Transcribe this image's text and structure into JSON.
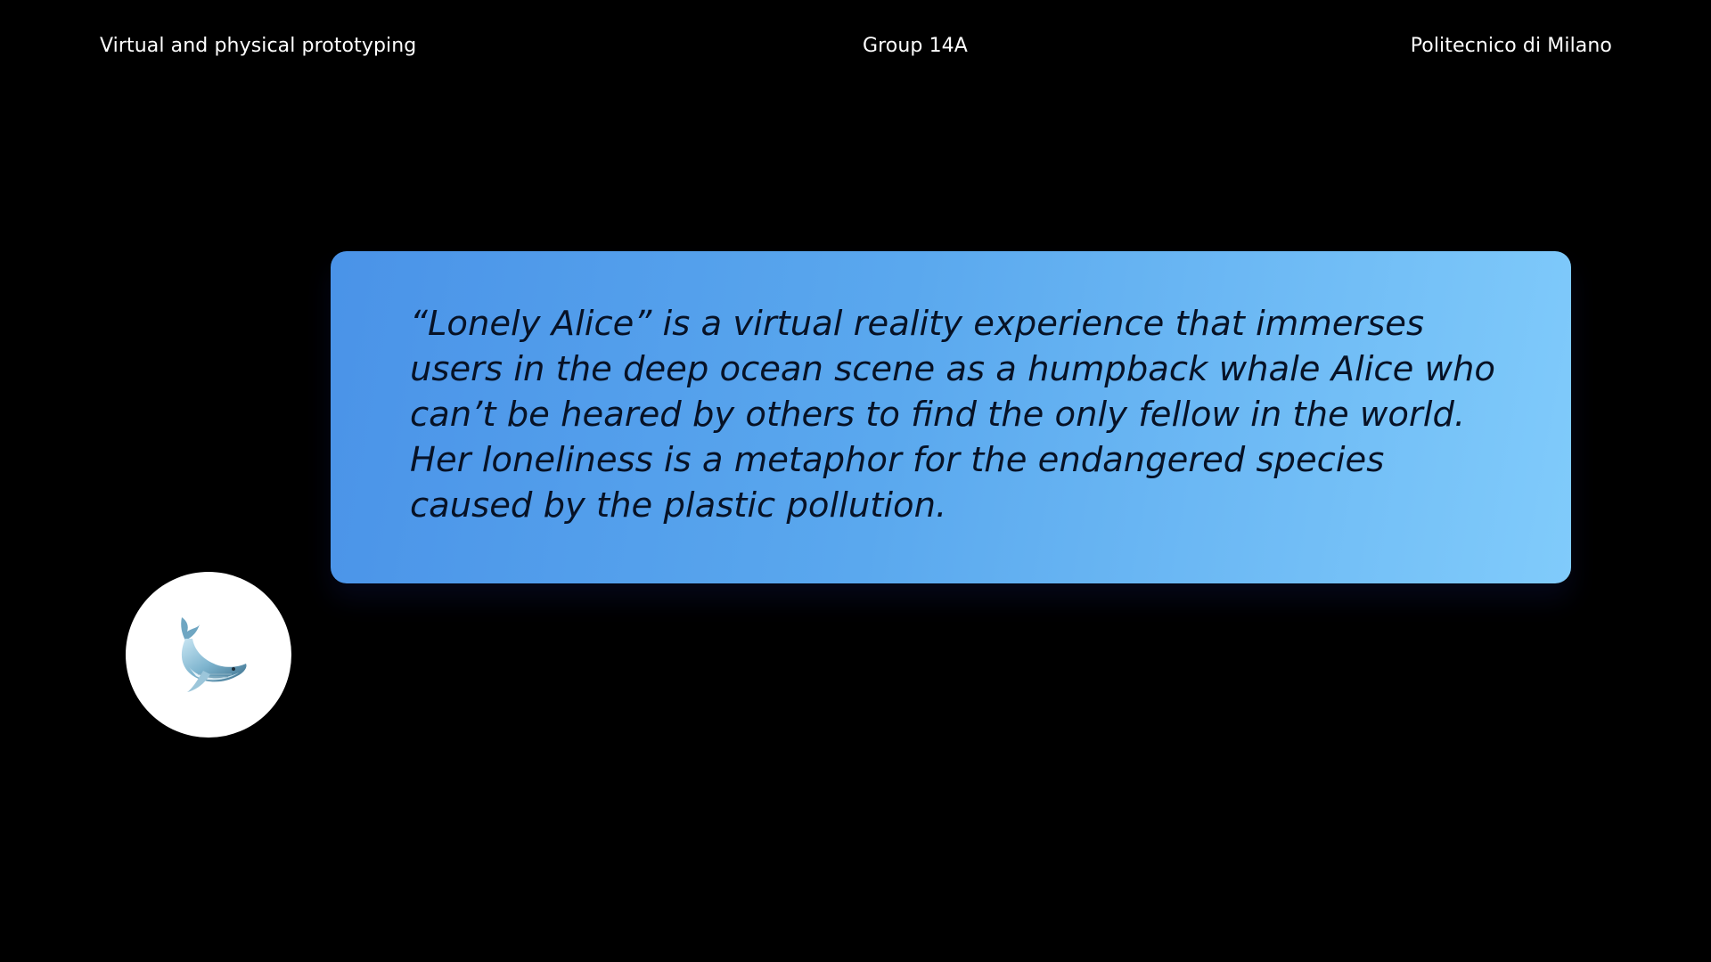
{
  "header": {
    "left": "Virtual and physical prototyping",
    "center": "Group 14A",
    "right": "Politecnico di Milano"
  },
  "message": {
    "text": "“Lonely Alice” is a virtual reality experience that immerses users in the deep ocean scene as a humpback whale Alice who can’t be heared by others to find the only fellow in the world. Her loneliness is a metaphor for the endangered species caused by the plastic pollution."
  },
  "avatar": {
    "icon": "whale-icon"
  },
  "colors": {
    "background": "#000000",
    "bubble_gradient_start": "#4a93e8",
    "bubble_gradient_end": "#80cbfb",
    "bubble_text": "#071226",
    "header_text": "#ffffff"
  }
}
